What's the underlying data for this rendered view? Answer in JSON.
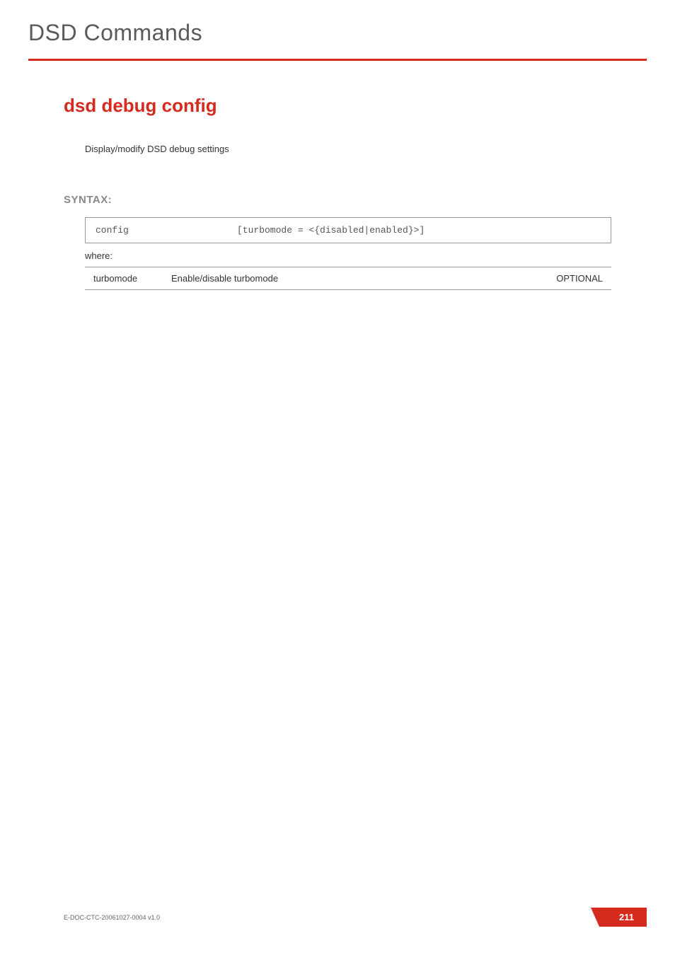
{
  "header": {
    "page_title": "DSD Commands"
  },
  "command": {
    "title": "dsd debug config",
    "description": "Display/modify DSD debug settings"
  },
  "syntax": {
    "label": "SYNTAX:",
    "cmd": "config",
    "args": "[turbomode = <{disabled|enabled}>]",
    "where": "where:",
    "params": [
      {
        "name": "turbomode",
        "desc": "Enable/disable turbomode",
        "req": "OPTIONAL"
      }
    ]
  },
  "footer": {
    "doc_id": "E-DOC-CTC-20061027-0004 v1.0",
    "page_number": "211"
  }
}
